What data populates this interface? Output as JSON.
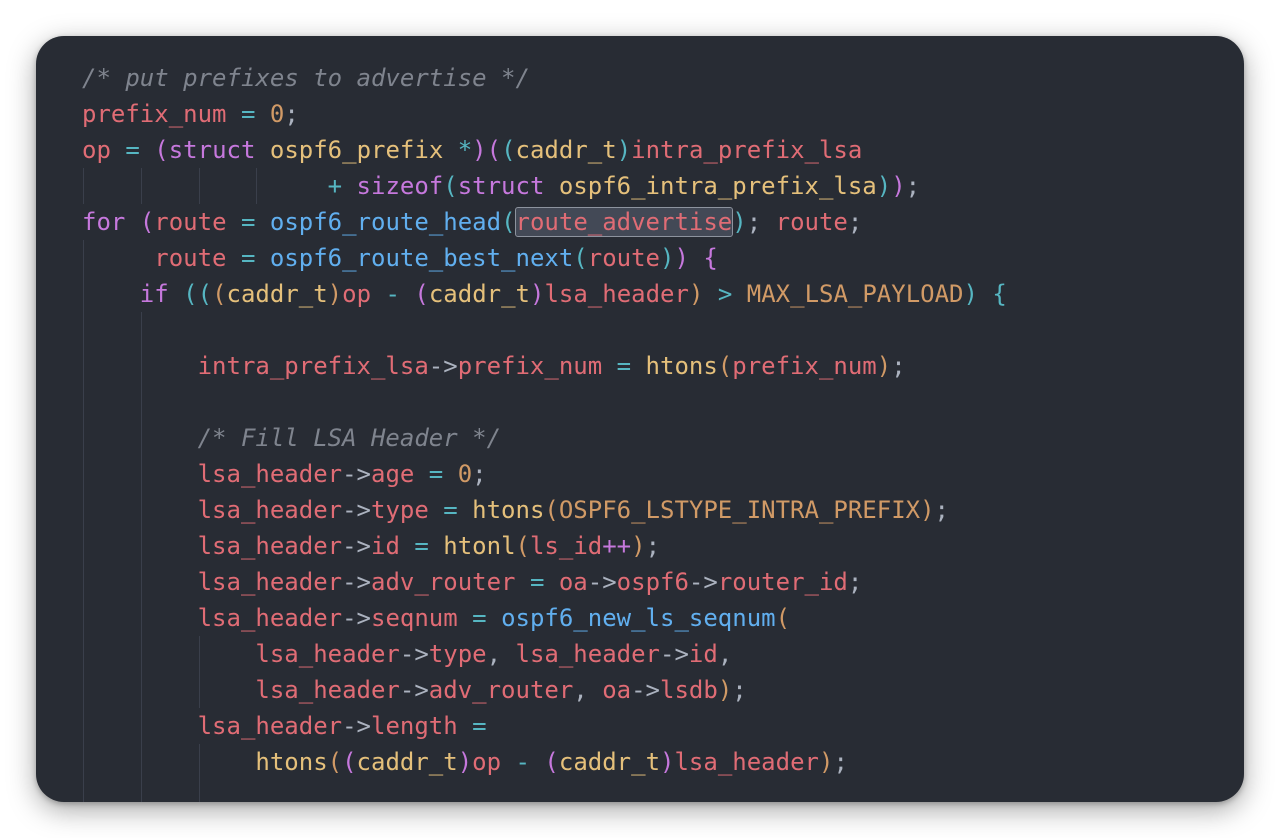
{
  "editor": {
    "language": "c",
    "theme_colors": {
      "background": "#282c34",
      "comment": "#7f848e",
      "variable": "#e06c75",
      "number": "#d19a66",
      "keyword": "#c678dd",
      "type": "#e5c07b",
      "function": "#61afef",
      "operator": "#56b6c2",
      "punctuation": "#abb2bf",
      "selection": "#434956"
    },
    "selected_text": "route_advertise",
    "lines": [
      {
        "guides": [],
        "tokens": [
          {
            "t": "/* put prefixes to advertise */",
            "c": "comment"
          }
        ]
      },
      {
        "guides": [],
        "tokens": [
          {
            "t": "prefix_num",
            "c": "var"
          },
          {
            "t": " = ",
            "c": "op"
          },
          {
            "t": "0",
            "c": "num"
          },
          {
            "t": ";",
            "c": "punc"
          }
        ]
      },
      {
        "guides": [],
        "tokens": [
          {
            "t": "op",
            "c": "var"
          },
          {
            "t": " = ",
            "c": "op"
          },
          {
            "t": "(",
            "c": "paren1"
          },
          {
            "t": "struct",
            "c": "kw"
          },
          {
            "t": " ",
            "c": "punc"
          },
          {
            "t": "ospf6_prefix",
            "c": "type"
          },
          {
            "t": " *",
            "c": "op"
          },
          {
            "t": ")",
            "c": "paren1"
          },
          {
            "t": "(",
            "c": "paren1"
          },
          {
            "t": "(",
            "c": "paren2"
          },
          {
            "t": "caddr_t",
            "c": "type"
          },
          {
            "t": ")",
            "c": "paren2"
          },
          {
            "t": "intra_prefix_lsa",
            "c": "var"
          }
        ]
      },
      {
        "guides": [
          0,
          4,
          8,
          12
        ],
        "tokens": [
          {
            "t": "                 ",
            "c": "punc"
          },
          {
            "t": "+ ",
            "c": "op"
          },
          {
            "t": "sizeof",
            "c": "kw"
          },
          {
            "t": "(",
            "c": "paren2"
          },
          {
            "t": "struct",
            "c": "kw"
          },
          {
            "t": " ",
            "c": "punc"
          },
          {
            "t": "ospf6_intra_prefix_lsa",
            "c": "type"
          },
          {
            "t": ")",
            "c": "paren2"
          },
          {
            "t": ")",
            "c": "paren1"
          },
          {
            "t": ";",
            "c": "punc"
          }
        ]
      },
      {
        "guides": [],
        "tokens": [
          {
            "t": "for",
            "c": "kw"
          },
          {
            "t": " ",
            "c": "punc"
          },
          {
            "t": "(",
            "c": "paren1"
          },
          {
            "t": "route",
            "c": "var"
          },
          {
            "t": " = ",
            "c": "op"
          },
          {
            "t": "ospf6_route_head",
            "c": "fn"
          },
          {
            "t": "(",
            "c": "paren2"
          },
          {
            "t": "route_advertise",
            "c": "var",
            "sel": true
          },
          {
            "t": ")",
            "c": "paren2"
          },
          {
            "t": "; ",
            "c": "punc"
          },
          {
            "t": "route",
            "c": "var"
          },
          {
            "t": ";",
            "c": "punc"
          }
        ]
      },
      {
        "guides": [
          0
        ],
        "tokens": [
          {
            "t": "     ",
            "c": "punc"
          },
          {
            "t": "route",
            "c": "var"
          },
          {
            "t": " = ",
            "c": "op"
          },
          {
            "t": "ospf6_route_best_next",
            "c": "fn"
          },
          {
            "t": "(",
            "c": "paren2"
          },
          {
            "t": "route",
            "c": "var"
          },
          {
            "t": ")",
            "c": "paren2"
          },
          {
            "t": ")",
            "c": "paren1"
          },
          {
            "t": " ",
            "c": "punc"
          },
          {
            "t": "{",
            "c": "paren1"
          }
        ]
      },
      {
        "guides": [
          0
        ],
        "tokens": [
          {
            "t": "    ",
            "c": "punc"
          },
          {
            "t": "if",
            "c": "kw"
          },
          {
            "t": " ",
            "c": "punc"
          },
          {
            "t": "(",
            "c": "paren2"
          },
          {
            "t": "(",
            "c": "paren2"
          },
          {
            "t": "(",
            "c": "paren3"
          },
          {
            "t": "caddr_t",
            "c": "type"
          },
          {
            "t": ")",
            "c": "paren3"
          },
          {
            "t": "op",
            "c": "var"
          },
          {
            "t": " - ",
            "c": "op"
          },
          {
            "t": "(",
            "c": "paren1"
          },
          {
            "t": "caddr_t",
            "c": "type"
          },
          {
            "t": ")",
            "c": "paren1"
          },
          {
            "t": "lsa_header",
            "c": "var"
          },
          {
            "t": ")",
            "c": "paren3"
          },
          {
            "t": " > ",
            "c": "op"
          },
          {
            "t": "MAX_LSA_PAYLOAD",
            "c": "const"
          },
          {
            "t": ")",
            "c": "paren2"
          },
          {
            "t": " ",
            "c": "punc"
          },
          {
            "t": "{",
            "c": "paren2"
          }
        ]
      },
      {
        "guides": [
          0,
          4
        ],
        "tokens": []
      },
      {
        "guides": [
          0,
          4
        ],
        "tokens": [
          {
            "t": "        ",
            "c": "punc"
          },
          {
            "t": "intra_prefix_lsa",
            "c": "var"
          },
          {
            "t": "->",
            "c": "punc"
          },
          {
            "t": "prefix_num",
            "c": "var"
          },
          {
            "t": " = ",
            "c": "op"
          },
          {
            "t": "htons",
            "c": "type"
          },
          {
            "t": "(",
            "c": "paren3"
          },
          {
            "t": "prefix_num",
            "c": "var"
          },
          {
            "t": ")",
            "c": "paren3"
          },
          {
            "t": ";",
            "c": "punc"
          }
        ]
      },
      {
        "guides": [
          0,
          4
        ],
        "tokens": []
      },
      {
        "guides": [
          0,
          4
        ],
        "tokens": [
          {
            "t": "        ",
            "c": "punc"
          },
          {
            "t": "/* Fill LSA Header */",
            "c": "comment"
          }
        ]
      },
      {
        "guides": [
          0,
          4
        ],
        "tokens": [
          {
            "t": "        ",
            "c": "punc"
          },
          {
            "t": "lsa_header",
            "c": "var"
          },
          {
            "t": "->",
            "c": "punc"
          },
          {
            "t": "age",
            "c": "var"
          },
          {
            "t": " = ",
            "c": "op"
          },
          {
            "t": "0",
            "c": "num"
          },
          {
            "t": ";",
            "c": "punc"
          }
        ]
      },
      {
        "guides": [
          0,
          4
        ],
        "tokens": [
          {
            "t": "        ",
            "c": "punc"
          },
          {
            "t": "lsa_header",
            "c": "var"
          },
          {
            "t": "->",
            "c": "punc"
          },
          {
            "t": "type",
            "c": "var"
          },
          {
            "t": " = ",
            "c": "op"
          },
          {
            "t": "htons",
            "c": "type"
          },
          {
            "t": "(",
            "c": "paren3"
          },
          {
            "t": "OSPF6_LSTYPE_INTRA_PREFIX",
            "c": "const"
          },
          {
            "t": ")",
            "c": "paren3"
          },
          {
            "t": ";",
            "c": "punc"
          }
        ]
      },
      {
        "guides": [
          0,
          4
        ],
        "tokens": [
          {
            "t": "        ",
            "c": "punc"
          },
          {
            "t": "lsa_header",
            "c": "var"
          },
          {
            "t": "->",
            "c": "punc"
          },
          {
            "t": "id",
            "c": "var"
          },
          {
            "t": " = ",
            "c": "op"
          },
          {
            "t": "htonl",
            "c": "type"
          },
          {
            "t": "(",
            "c": "paren3"
          },
          {
            "t": "ls_id",
            "c": "var"
          },
          {
            "t": "++",
            "c": "kw"
          },
          {
            "t": ")",
            "c": "paren3"
          },
          {
            "t": ";",
            "c": "punc"
          }
        ]
      },
      {
        "guides": [
          0,
          4
        ],
        "tokens": [
          {
            "t": "        ",
            "c": "punc"
          },
          {
            "t": "lsa_header",
            "c": "var"
          },
          {
            "t": "->",
            "c": "punc"
          },
          {
            "t": "adv_router",
            "c": "var"
          },
          {
            "t": " = ",
            "c": "op"
          },
          {
            "t": "oa",
            "c": "var"
          },
          {
            "t": "->",
            "c": "punc"
          },
          {
            "t": "ospf6",
            "c": "var"
          },
          {
            "t": "->",
            "c": "punc"
          },
          {
            "t": "router_id",
            "c": "var"
          },
          {
            "t": ";",
            "c": "punc"
          }
        ]
      },
      {
        "guides": [
          0,
          4
        ],
        "tokens": [
          {
            "t": "        ",
            "c": "punc"
          },
          {
            "t": "lsa_header",
            "c": "var"
          },
          {
            "t": "->",
            "c": "punc"
          },
          {
            "t": "seqnum",
            "c": "var"
          },
          {
            "t": " = ",
            "c": "op"
          },
          {
            "t": "ospf6_new_ls_seqnum",
            "c": "fn"
          },
          {
            "t": "(",
            "c": "paren3"
          }
        ]
      },
      {
        "guides": [
          0,
          4,
          8
        ],
        "tokens": [
          {
            "t": "            ",
            "c": "punc"
          },
          {
            "t": "lsa_header",
            "c": "var"
          },
          {
            "t": "->",
            "c": "punc"
          },
          {
            "t": "type",
            "c": "var"
          },
          {
            "t": ", ",
            "c": "punc"
          },
          {
            "t": "lsa_header",
            "c": "var"
          },
          {
            "t": "->",
            "c": "punc"
          },
          {
            "t": "id",
            "c": "var"
          },
          {
            "t": ",",
            "c": "punc"
          }
        ]
      },
      {
        "guides": [
          0,
          4,
          8
        ],
        "tokens": [
          {
            "t": "            ",
            "c": "punc"
          },
          {
            "t": "lsa_header",
            "c": "var"
          },
          {
            "t": "->",
            "c": "punc"
          },
          {
            "t": "adv_router",
            "c": "var"
          },
          {
            "t": ", ",
            "c": "punc"
          },
          {
            "t": "oa",
            "c": "var"
          },
          {
            "t": "->",
            "c": "punc"
          },
          {
            "t": "lsdb",
            "c": "var"
          },
          {
            "t": ")",
            "c": "paren3"
          },
          {
            "t": ";",
            "c": "punc"
          }
        ]
      },
      {
        "guides": [
          0,
          4
        ],
        "tokens": [
          {
            "t": "        ",
            "c": "punc"
          },
          {
            "t": "lsa_header",
            "c": "var"
          },
          {
            "t": "->",
            "c": "punc"
          },
          {
            "t": "length",
            "c": "var"
          },
          {
            "t": " =",
            "c": "op"
          }
        ]
      },
      {
        "guides": [
          0,
          4,
          8
        ],
        "tokens": [
          {
            "t": "            ",
            "c": "punc"
          },
          {
            "t": "htons",
            "c": "type"
          },
          {
            "t": "(",
            "c": "paren3"
          },
          {
            "t": "(",
            "c": "paren1"
          },
          {
            "t": "caddr_t",
            "c": "type"
          },
          {
            "t": ")",
            "c": "paren1"
          },
          {
            "t": "op",
            "c": "var"
          },
          {
            "t": " - ",
            "c": "op"
          },
          {
            "t": "(",
            "c": "paren1"
          },
          {
            "t": "caddr_t",
            "c": "type"
          },
          {
            "t": ")",
            "c": "paren1"
          },
          {
            "t": "lsa_header",
            "c": "var"
          },
          {
            "t": ")",
            "c": "paren3"
          },
          {
            "t": ";",
            "c": "punc"
          }
        ]
      },
      {
        "guides": [
          0,
          4,
          8
        ],
        "tokens": []
      }
    ]
  }
}
